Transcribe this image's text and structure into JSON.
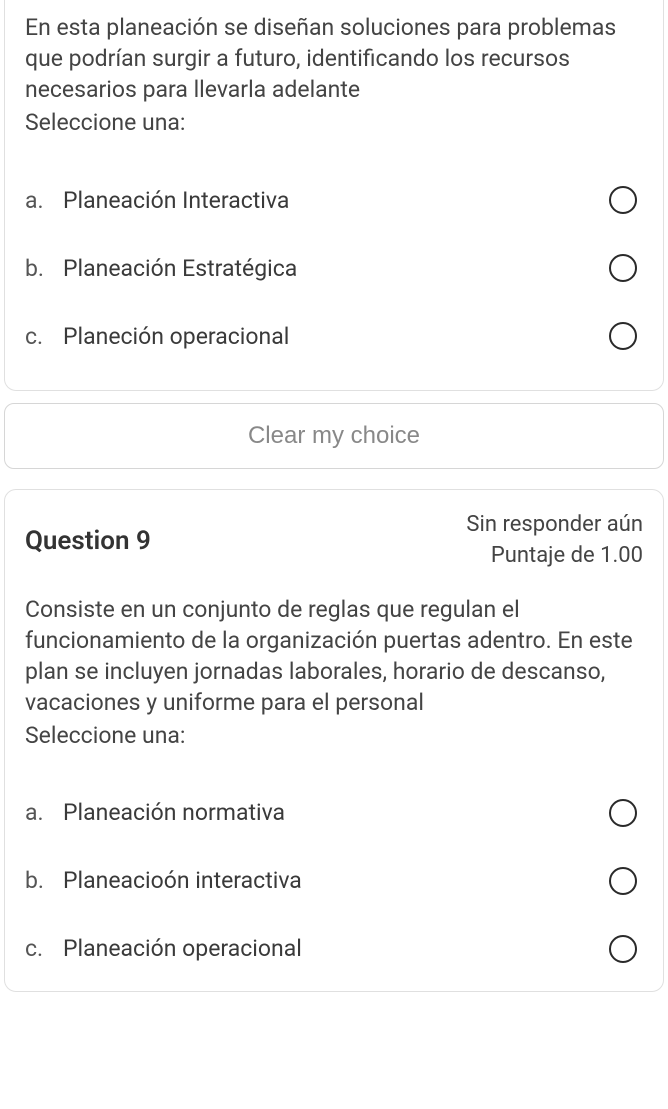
{
  "question8": {
    "prompt": "En esta planeación se diseñan soluciones para problemas que podrían surgir a futuro, identificando los recursos necesarios para llevarla adelante",
    "selectOne": "Seleccione una:",
    "options": {
      "a": {
        "letter": "a.",
        "label": "Planeación Interactiva"
      },
      "b": {
        "letter": "b.",
        "label": "Planeación Estratégica"
      },
      "c": {
        "letter": "c.",
        "label": "Planeción operacional"
      }
    },
    "clearLabel": "Clear my choice"
  },
  "question9": {
    "title": "Question 9",
    "statusLine1": "Sin responder aún",
    "statusLine2": "Puntaje de 1.00",
    "prompt": "Consiste en un conjunto de reglas que regulan el funcionamiento de la organización puertas adentro. En este plan se incluyen jornadas laborales, horario de descanso, vacaciones y uniforme para el personal",
    "selectOne": "Seleccione una:",
    "options": {
      "a": {
        "letter": "a.",
        "label": "Planeación normativa"
      },
      "b": {
        "letter": "b.",
        "label": "Planeacioón interactiva"
      },
      "c": {
        "letter": "c.",
        "label": "Planeación operacional"
      }
    }
  }
}
